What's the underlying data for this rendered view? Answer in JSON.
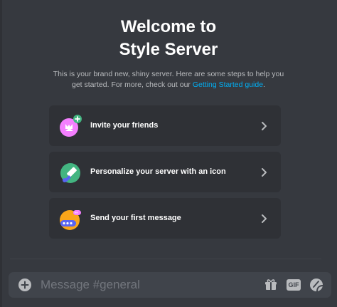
{
  "welcome": {
    "title_line1": "Welcome to",
    "title_line2": "Style Server",
    "subtitle_text": "This is your brand new, shiny server. Here are some steps to help you get started. For more, check out our ",
    "subtitle_link": "Getting Started guide",
    "subtitle_end": "."
  },
  "cards": [
    {
      "label": "Invite your friends",
      "icon": "invite-friends-icon"
    },
    {
      "label": "Personalize your server with an icon",
      "icon": "personalize-icon"
    },
    {
      "label": "Send your first message",
      "icon": "first-message-icon"
    }
  ],
  "composer": {
    "placeholder": "Message #general",
    "gif_label": "GIF"
  },
  "colors": {
    "background": "#36393f",
    "card": "#2f3136",
    "composer": "#40444b",
    "link": "#00aff4",
    "invite_accent": "#f47fff",
    "personalize_accent": "#43b581",
    "message_accent": "#faa61a"
  }
}
